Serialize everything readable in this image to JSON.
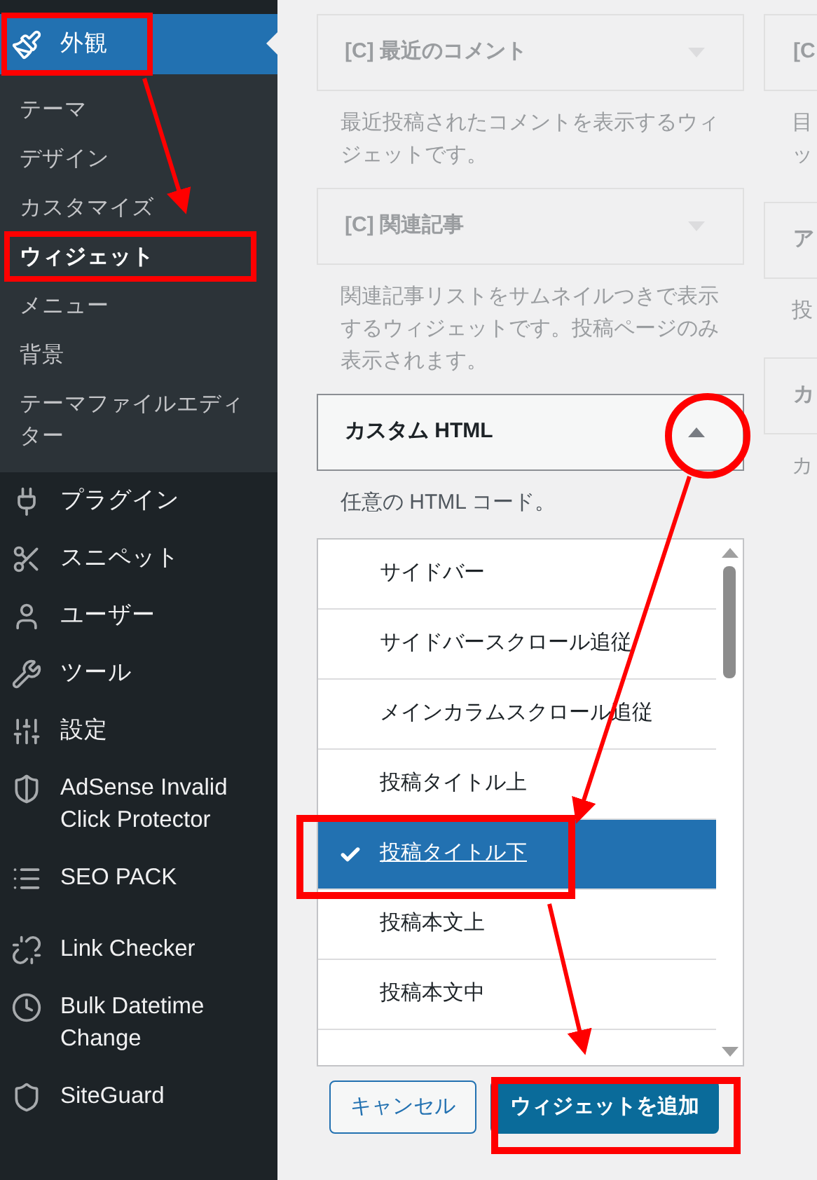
{
  "sidebar": {
    "items": [
      {
        "label": "外観",
        "selected": true,
        "children": [
          {
            "label": "テーマ",
            "selected": false
          },
          {
            "label": "デザイン",
            "selected": false
          },
          {
            "label": "カスタマイズ",
            "selected": false
          },
          {
            "label": "ウィジェット",
            "selected": true
          },
          {
            "label": "メニュー",
            "selected": false
          },
          {
            "label": "背景",
            "selected": false
          },
          {
            "label": "テーマファイルエディター",
            "selected": false
          }
        ]
      },
      {
        "label": "プラグイン",
        "selected": false
      },
      {
        "label": "スニペット",
        "selected": false
      },
      {
        "label": "ユーザー",
        "selected": false
      },
      {
        "label": "ツール",
        "selected": false
      },
      {
        "label": "設定",
        "selected": false
      },
      {
        "label": "AdSense Invalid Click Protector",
        "selected": false
      },
      {
        "label": "SEO PACK",
        "selected": false
      },
      {
        "label": "Link Checker",
        "selected": false
      },
      {
        "label": "Bulk Datetime Change",
        "selected": false
      },
      {
        "label": "SiteGuard",
        "selected": false
      }
    ]
  },
  "widgets": [
    {
      "title": "[C] 最近のコメント",
      "description": "最近投稿されたコメントを表示するウィジェットです。",
      "expanded": false
    },
    {
      "title": "[C] 関連記事",
      "description": "関連記事リストをサムネイルつきで表示するウィジェットです。投稿ページのみ表示されます。",
      "expanded": false
    },
    {
      "title": "カスタム HTML",
      "description": "任意の HTML コード。",
      "expanded": true,
      "areas": [
        {
          "label": "サイドバー",
          "selected": false
        },
        {
          "label": "サイドバースクロール追従",
          "selected": false
        },
        {
          "label": "メインカラムスクロール追従",
          "selected": false
        },
        {
          "label": "投稿タイトル上",
          "selected": false
        },
        {
          "label": "投稿タイトル下",
          "selected": true
        },
        {
          "label": "投稿本文上",
          "selected": false
        },
        {
          "label": "投稿本文中",
          "selected": false
        }
      ],
      "buttons": {
        "cancel": "キャンセル",
        "add": "ウィジェットを追加"
      }
    }
  ],
  "widgets_column_2": [
    {
      "title": "[C",
      "description_lines": [
        "目",
        "ッ"
      ]
    },
    {
      "title": "ア",
      "description_lines": [
        "投"
      ]
    },
    {
      "title": "カ",
      "description_lines": [
        "カ"
      ]
    }
  ]
}
